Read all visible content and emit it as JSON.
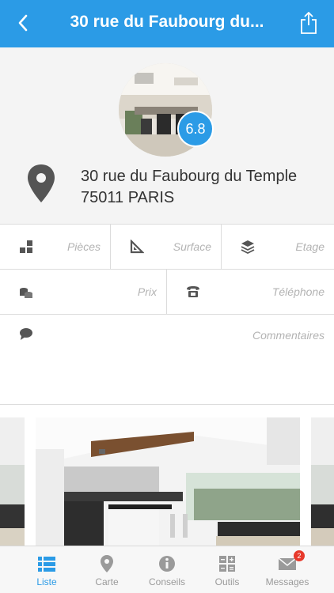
{
  "header": {
    "title": "30 rue du Faubourg du...",
    "back_icon": "chevron-left-icon",
    "share_icon": "share-icon"
  },
  "property": {
    "score": "6.8",
    "address_line1": "30 rue du Faubourg du Temple",
    "address_line2": "75011 PARIS"
  },
  "fields": {
    "rooms": "Pièces",
    "surface": "Surface",
    "floor": "Etage",
    "price": "Prix",
    "phone": "Téléphone",
    "comments": "Commentaires"
  },
  "tabs": [
    {
      "label": "Liste",
      "icon": "list-icon",
      "active": true
    },
    {
      "label": "Carte",
      "icon": "map-pin-icon",
      "active": false
    },
    {
      "label": "Conseils",
      "icon": "info-icon",
      "active": false
    },
    {
      "label": "Outils",
      "icon": "tools-grid-icon",
      "active": false
    },
    {
      "label": "Messages",
      "icon": "envelope-icon",
      "active": false,
      "badge": "2"
    }
  ],
  "colors": {
    "accent": "#2b9be6",
    "badge": "#e7392b",
    "icon_gray": "#555555"
  }
}
